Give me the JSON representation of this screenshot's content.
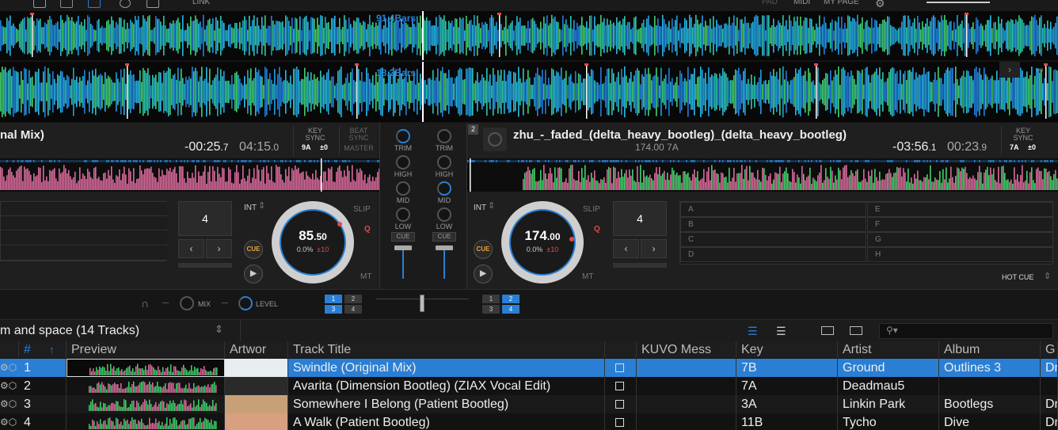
{
  "topbar": {
    "link_label": "LINK",
    "pad_label": "PAD",
    "midi_label": "MIDI",
    "mypage_label": "MY PAGE"
  },
  "waveforms": {
    "deck1_bars": "91.4Bars",
    "deck2_bars": "18.2Bars"
  },
  "deck1": {
    "title": "nal Mix)",
    "time_remaining": "-00:25",
    "time_remaining_dec": ".7",
    "time_total": "04:15",
    "time_total_dec": ".0",
    "key_label": "KEY",
    "sync_label": "SYNC",
    "key_value": "9A",
    "key_shift": "±0",
    "beat_label": "BEAT",
    "beat_sync_label": "SYNC",
    "master_label": "MASTER",
    "loop_value": "4",
    "int_label": "INT",
    "slip_label": "SLIP",
    "q_label": "Q",
    "mt_label": "MT",
    "cue_label": "CUE",
    "bpm_int": "85",
    "bpm_dec": ".50",
    "pitch_pct": "0.0%",
    "pitch_range": "±10"
  },
  "deck2": {
    "number": "2",
    "title": "zhu_-_faded_(delta_heavy_bootleg)_(delta_heavy_bootleg)",
    "bpm_key": "174.00 7A",
    "time_remaining": "-03:56",
    "time_remaining_dec": ".1",
    "time_total": "00:23",
    "time_total_dec": ".9",
    "key_label": "KEY",
    "sync_label": "SYNC",
    "key_value": "7A",
    "key_shift": "±0",
    "loop_value": "4",
    "int_label": "INT",
    "slip_label": "SLIP",
    "q_label": "Q",
    "mt_label": "MT",
    "cue_label": "CUE",
    "bpm_int": "174",
    "bpm_dec": ".00",
    "pitch_pct": "0.0%",
    "pitch_range": "±10",
    "hotcue_label": "HOT CUE",
    "hotcues": [
      "A",
      "B",
      "C",
      "D",
      "E",
      "F",
      "G",
      "H"
    ]
  },
  "mixer": {
    "trim": "TRIM",
    "high": "HIGH",
    "mid": "MID",
    "low": "LOW",
    "cue": "CUE"
  },
  "fx": {
    "mix_label": "MIX",
    "level_label": "LEVEL",
    "left_nums": [
      "1",
      "2",
      "3",
      "4"
    ],
    "right_nums": [
      "1",
      "2",
      "3",
      "4"
    ]
  },
  "browser": {
    "playlist": "m and space (14 Tracks)"
  },
  "table": {
    "headers": [
      "#",
      "Preview",
      "Artwor",
      "Track Title",
      "KUVO Mess",
      "Key",
      "Artist",
      "Album",
      "G"
    ],
    "rows": [
      {
        "num": "1",
        "title": "Swindle (Original Mix)",
        "key": "7B",
        "artist": "Ground",
        "album": "Outlines 3",
        "genre": "Dr"
      },
      {
        "num": "2",
        "title": "Avarita (Dimension Bootleg) (ZIAX Vocal Edit)",
        "key": "7A",
        "artist": "Deadmau5",
        "album": "",
        "genre": ""
      },
      {
        "num": "3",
        "title": "Somewhere I Belong (Patient Bootleg)",
        "key": "3A",
        "artist": "Linkin Park",
        "album": "Bootlegs",
        "genre": "Dr"
      },
      {
        "num": "4",
        "title": "A Walk (Patient Bootleg)",
        "key": "11B",
        "artist": "Tycho",
        "album": "Dive",
        "genre": "Dr"
      }
    ]
  }
}
